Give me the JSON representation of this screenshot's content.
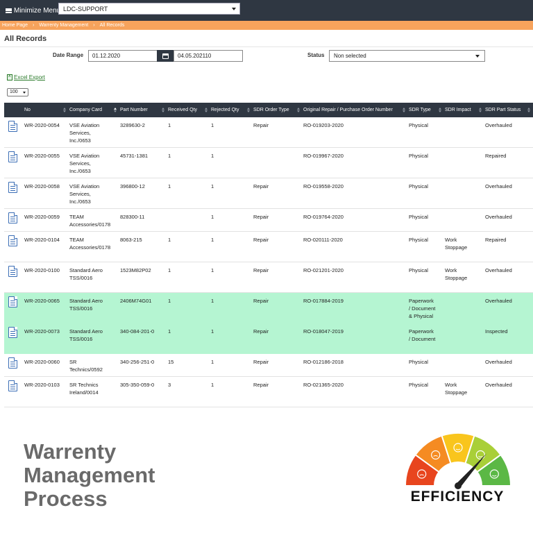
{
  "topbar": {
    "menu_label": "Minimize Menu",
    "org_value": "LDC-SUPPORT"
  },
  "breadcrumb": [
    "Home Page",
    "Warrenty Management",
    "All Records"
  ],
  "page_title": "All Records",
  "filters": {
    "date_label": "Date Range",
    "date_from": "01.12.2020",
    "date_to": "04.05.202110",
    "status_label": "Status",
    "status_value": "Non selected"
  },
  "excel_label": "Excel Export",
  "page_size": "100",
  "table": {
    "columns": [
      "No",
      "Company Card",
      "Part Number",
      "Received Qty",
      "Rejected Qty",
      "SDR Order Type",
      "Original Repair / Purchase Order Number",
      "SDR Type",
      "SDR Impact",
      "SDR Part Status"
    ],
    "rows": [
      {
        "no": "WR-2020-0054",
        "company": [
          "VSE Aviation",
          "Services,",
          "Inc./0653"
        ],
        "part": "3289630-2",
        "rec": "1",
        "rej": "1",
        "order_type": "Repair",
        "po": "RO-019203-2020",
        "sdr_type": [
          "Physical"
        ],
        "impact": [],
        "status": "Overhauled",
        "highlight": false
      },
      {
        "no": "WR-2020-0055",
        "company": [
          "VSE Aviation",
          "Services,",
          "Inc./0653"
        ],
        "part": "45731-1381",
        "rec": "1",
        "rej": "1",
        "order_type": "",
        "po": "RO-019967-2020",
        "sdr_type": [
          "Physical"
        ],
        "impact": [],
        "status": "Repaired",
        "highlight": false
      },
      {
        "no": "WR-2020-0058",
        "company": [
          "VSE Aviation",
          "Services,",
          "Inc./0653"
        ],
        "part": "396800-12",
        "rec": "1",
        "rej": "1",
        "order_type": "Repair",
        "po": "RO-019558-2020",
        "sdr_type": [
          "Physical"
        ],
        "impact": [],
        "status": "Overhauled",
        "highlight": false
      },
      {
        "no": "WR-2020-0059",
        "company": [
          "TEAM",
          "Accessories/0178"
        ],
        "part": "828300-11",
        "rec": "",
        "rej": "1",
        "order_type": "Repair",
        "po": "RO-019764-2020",
        "sdr_type": [
          "Physical"
        ],
        "impact": [],
        "status": "Overhauled",
        "highlight": false
      },
      {
        "no": "WR-2020-0104",
        "company": [
          "TEAM",
          "Accessories/0178"
        ],
        "part": "8063-215",
        "rec": "1",
        "rej": "1",
        "order_type": "Repair",
        "po": "RO-020111-2020",
        "sdr_type": [
          "Physical"
        ],
        "impact": [
          "Work",
          "Stoppage"
        ],
        "status": "Repaired",
        "highlight": false
      },
      {
        "no": "WR-2020-0100",
        "company": [
          "Standard Aero",
          "TSS/0016"
        ],
        "part": "1523M82P02",
        "rec": "1",
        "rej": "1",
        "order_type": "Repair",
        "po": "RO-021201-2020",
        "sdr_type": [
          "Physical"
        ],
        "impact": [
          "Work",
          "Stoppage"
        ],
        "status": "Overhauled",
        "highlight": false
      },
      {
        "no": "WR-2020-0065",
        "company": [
          "Standard Aero",
          "TSS/0016"
        ],
        "part": "2406M74G01",
        "rec": "1",
        "rej": "1",
        "order_type": "Repair",
        "po": "RO-017884-2019",
        "sdr_type": [
          "Paperwork",
          "/ Document",
          "& Physical"
        ],
        "impact": [],
        "status": "Overhauled",
        "highlight": true
      },
      {
        "no": "WR-2020-0073",
        "company": [
          "Standard Aero",
          "TSS/0016"
        ],
        "part": "340-084-201-0",
        "rec": "1",
        "rej": "1",
        "order_type": "Repair",
        "po": "RO-018047-2019",
        "sdr_type": [
          "Paperwork",
          "/ Document"
        ],
        "impact": [],
        "status": "Inspected",
        "highlight": true
      },
      {
        "no": "WR-2020-0060",
        "company": [
          "SR",
          "Technics/0592"
        ],
        "part": "340-256-251-0",
        "rec": "15",
        "rej": "1",
        "order_type": "Repair",
        "po": "RO-012186-2018",
        "sdr_type": [
          "Physical"
        ],
        "impact": [],
        "status": "Overhauled",
        "highlight": false
      },
      {
        "no": "WR-2020-0103",
        "company": [
          "SR Technics",
          "Ireland/0014"
        ],
        "part": "305-350-059-0",
        "rec": "3",
        "rej": "1",
        "order_type": "Repair",
        "po": "RO-021365-2020",
        "sdr_type": [
          "Physical"
        ],
        "impact": [
          "Work",
          "Stoppage"
        ],
        "status": "Overhauled",
        "highlight": false
      }
    ]
  },
  "banner": {
    "title_lines": [
      "Warrenty",
      "Management",
      "Process"
    ],
    "gauge_label": "EFFICIENCY",
    "gauge_colors": [
      "#e8451e",
      "#f58b22",
      "#f9c51d",
      "#a9cf38",
      "#5bb845"
    ]
  }
}
